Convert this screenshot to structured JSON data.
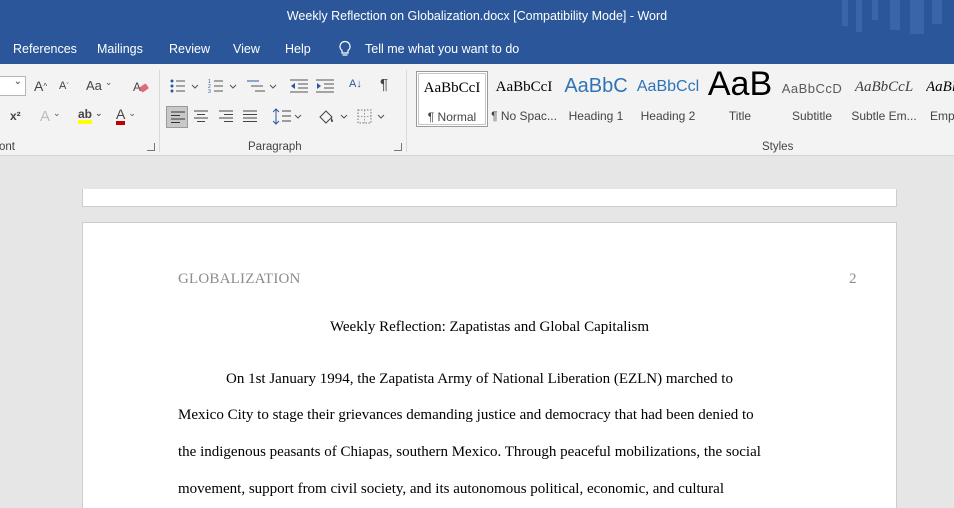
{
  "window": {
    "title": "Weekly Reflection on Globalization.docx [Compatibility Mode]  -  Word"
  },
  "menu": {
    "tabs": [
      "References",
      "Mailings",
      "Review",
      "View",
      "Help"
    ],
    "tell_me": "Tell me what you want to do"
  },
  "ribbon": {
    "groups": {
      "font": "ont",
      "paragraph": "Paragraph",
      "styles": "Styles"
    },
    "font": {
      "grow_label": "A",
      "shrink_label": "A",
      "case_label": "Aa",
      "superscript_label": "x²",
      "effects_label": "A",
      "highlight_label": "ab",
      "color_label": "A",
      "colors": {
        "highlight": "#ffff00",
        "font_color": "#c00000"
      }
    },
    "paragraph": {
      "sort_label": "A↓",
      "pilcrow_label": "¶"
    },
    "styles": [
      {
        "preview": "AaBbCcI",
        "name": "¶ Normal"
      },
      {
        "preview": "AaBbCcI",
        "name": "¶ No Spac..."
      },
      {
        "preview": "AaBbC",
        "name": "Heading 1"
      },
      {
        "preview": "AaBbCcl",
        "name": "Heading 2"
      },
      {
        "preview": "AaB",
        "name": "Title"
      },
      {
        "preview": "AaBbCcD",
        "name": "Subtitle"
      },
      {
        "preview": "AaBbCcL",
        "name": "Subtle Em..."
      },
      {
        "preview": "AaBl",
        "name": "Emp"
      }
    ]
  },
  "document": {
    "running_head": "GLOBALIZATION",
    "page_number": "2",
    "title": "Weekly Reflection: Zapatistas and Global Capitalism",
    "lines": [
      "On 1st January 1994, the Zapatista Army of National Liberation (EZLN) marched to",
      "Mexico City to stage their grievances demanding justice and democracy that had been denied to",
      "the indigenous peasants of Chiapas, southern Mexico. Through peaceful mobilizations, the social",
      "movement, support from civil society, and its autonomous political, economic, and cultural"
    ]
  }
}
